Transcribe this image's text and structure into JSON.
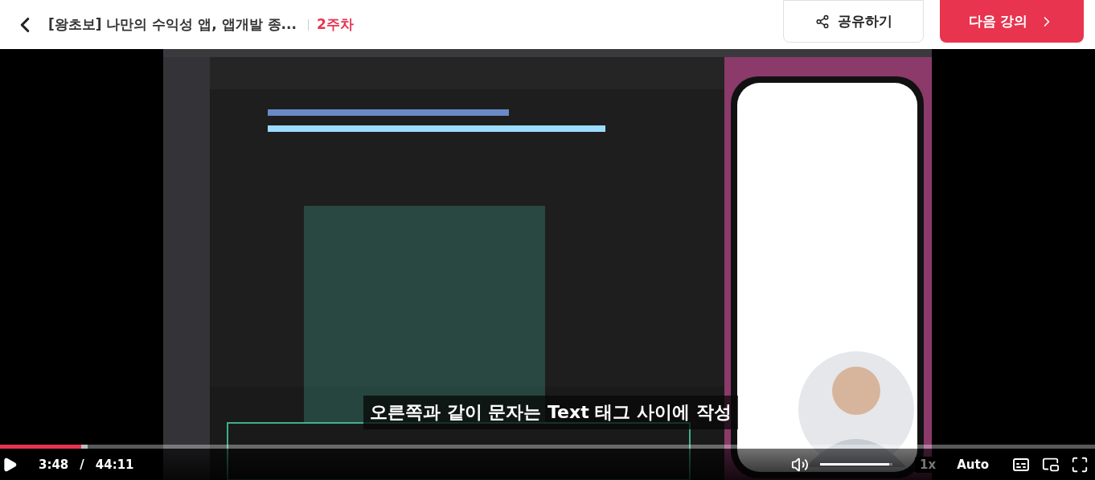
{
  "header": {
    "title": "[왕초보] 나만의 수익성 앱, 앱개발 종...",
    "week": "2주차",
    "share": "공유하기",
    "next": "다음 강의"
  },
  "video": {
    "kind": "picture",
    "caption": "오른쪽과 같이 문자는 Text 태그 사이에 작성"
  },
  "player": {
    "progress": {
      "level": 0.074,
      "buffered": {
        "level": 0.08
      }
    },
    "current": "3:48",
    "separator": "/",
    "duration": "44:11",
    "volume": {
      "level": 0.95
    },
    "speed": "1x",
    "quality": "Auto"
  }
}
